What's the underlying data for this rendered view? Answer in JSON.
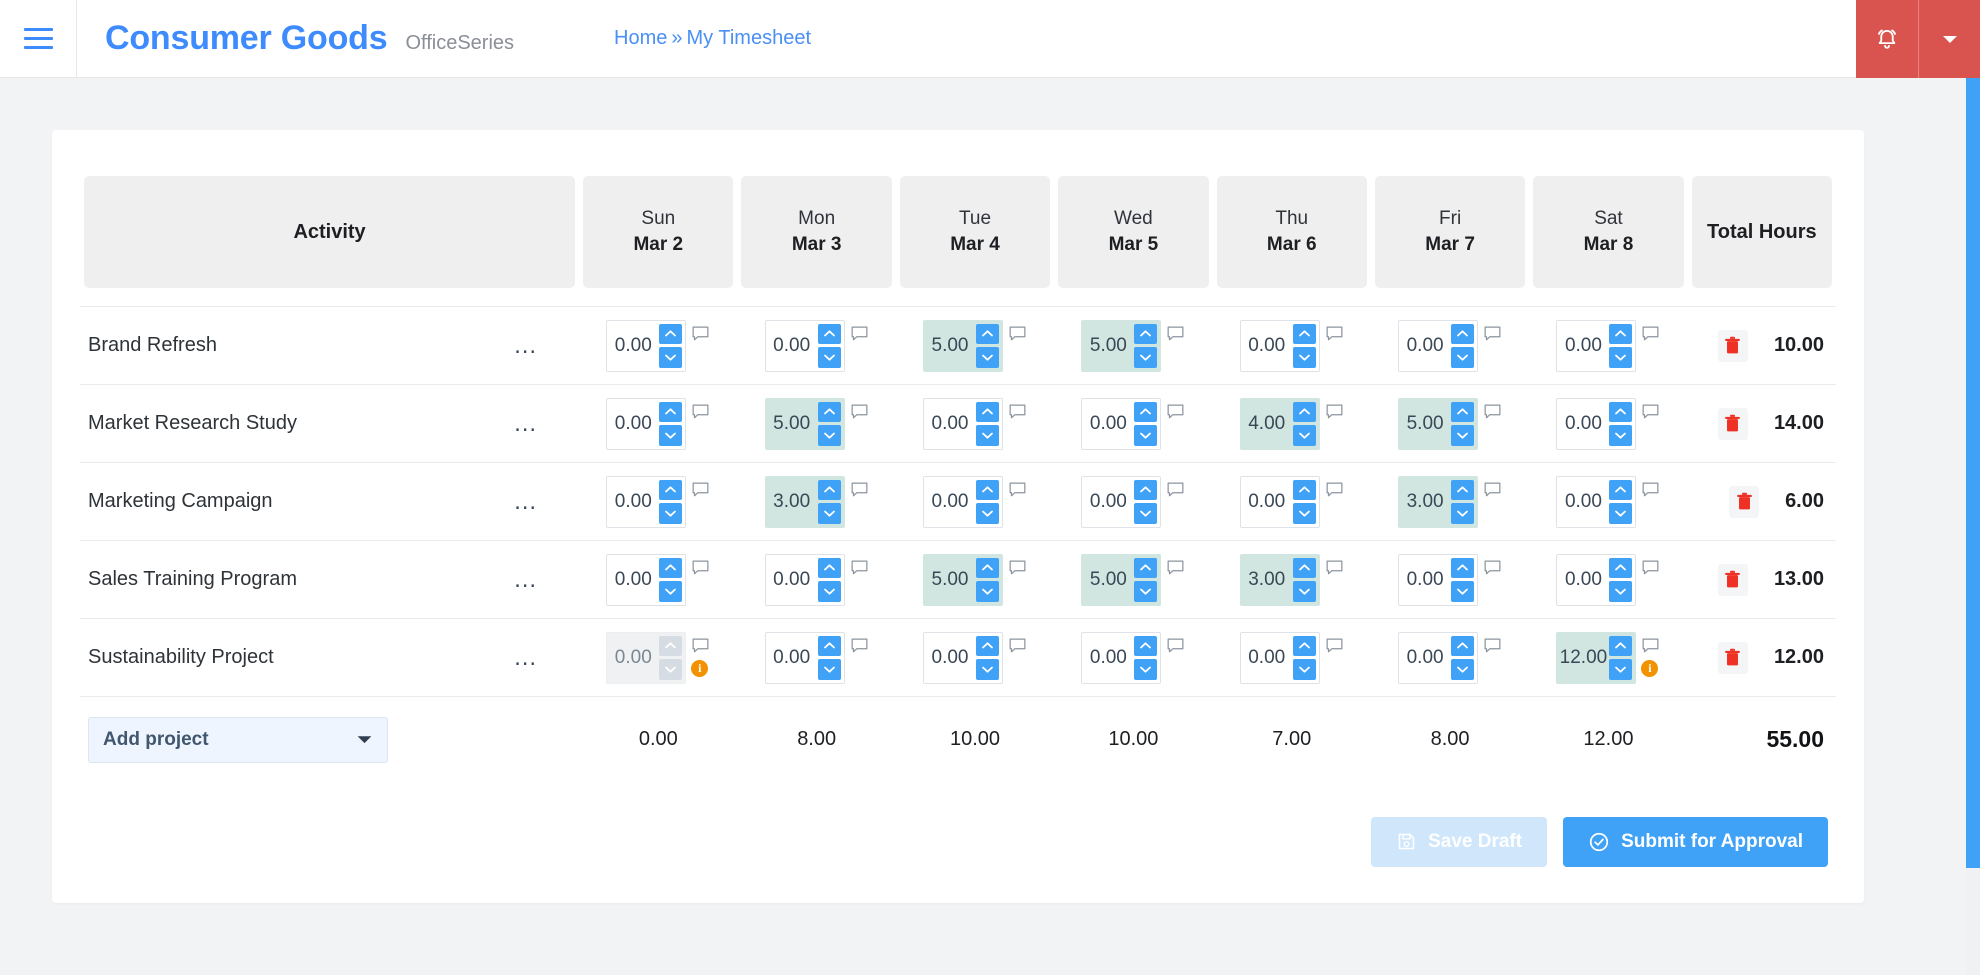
{
  "header": {
    "brand_title": "Consumer Goods",
    "brand_subtitle": "OfficeSeries",
    "breadcrumb": {
      "home": "Home",
      "separator": "»",
      "current": "My Timesheet"
    },
    "notification_icon": "alarm-bell-icon",
    "notification_caret_icon": "chevron-down-icon",
    "menu_icon": "hamburger-menu-icon",
    "accent_color": "#3d8bfd",
    "alert_color": "#d9534f"
  },
  "table": {
    "activity_header": "Activity",
    "total_header": "Total Hours",
    "days": [
      {
        "dow": "Sun",
        "date": "Mar 2"
      },
      {
        "dow": "Mon",
        "date": "Mar 3"
      },
      {
        "dow": "Tue",
        "date": "Mar 4"
      },
      {
        "dow": "Wed",
        "date": "Mar 5"
      },
      {
        "dow": "Thu",
        "date": "Mar 6"
      },
      {
        "dow": "Fri",
        "date": "Mar 7"
      },
      {
        "dow": "Sat",
        "date": "Mar 8"
      }
    ],
    "rows": [
      {
        "activity": "Brand Refresh",
        "menu_icon": "ellipsis-icon",
        "values": [
          "0.00",
          "0.00",
          "5.00",
          "5.00",
          "0.00",
          "0.00",
          "0.00"
        ],
        "filled": [
          false,
          false,
          true,
          true,
          false,
          false,
          false
        ],
        "disabled": [
          false,
          false,
          false,
          false,
          false,
          false,
          false
        ],
        "warnings": [
          false,
          false,
          false,
          false,
          false,
          false,
          false
        ],
        "total": "10.00"
      },
      {
        "activity": "Market Research Study",
        "menu_icon": "ellipsis-icon",
        "values": [
          "0.00",
          "5.00",
          "0.00",
          "0.00",
          "4.00",
          "5.00",
          "0.00"
        ],
        "filled": [
          false,
          true,
          false,
          false,
          true,
          true,
          false
        ],
        "disabled": [
          false,
          false,
          false,
          false,
          false,
          false,
          false
        ],
        "warnings": [
          false,
          false,
          false,
          false,
          false,
          false,
          false
        ],
        "total": "14.00"
      },
      {
        "activity": "Marketing Campaign",
        "menu_icon": "ellipsis-icon",
        "values": [
          "0.00",
          "3.00",
          "0.00",
          "0.00",
          "0.00",
          "3.00",
          "0.00"
        ],
        "filled": [
          false,
          true,
          false,
          false,
          false,
          true,
          false
        ],
        "disabled": [
          false,
          false,
          false,
          false,
          false,
          false,
          false
        ],
        "warnings": [
          false,
          false,
          false,
          false,
          false,
          false,
          false
        ],
        "total": "6.00"
      },
      {
        "activity": "Sales Training Program",
        "menu_icon": "ellipsis-icon",
        "values": [
          "0.00",
          "0.00",
          "5.00",
          "5.00",
          "3.00",
          "0.00",
          "0.00"
        ],
        "filled": [
          false,
          false,
          true,
          true,
          true,
          false,
          false
        ],
        "disabled": [
          false,
          false,
          false,
          false,
          false,
          false,
          false
        ],
        "warnings": [
          false,
          false,
          false,
          false,
          false,
          false,
          false
        ],
        "total": "13.00"
      },
      {
        "activity": "Sustainability Project",
        "menu_icon": "ellipsis-icon",
        "values": [
          "0.00",
          "0.00",
          "0.00",
          "0.00",
          "0.00",
          "0.00",
          "12.00"
        ],
        "filled": [
          false,
          false,
          false,
          false,
          false,
          false,
          true
        ],
        "disabled": [
          true,
          false,
          false,
          false,
          false,
          false,
          false
        ],
        "warnings": [
          true,
          false,
          false,
          false,
          false,
          false,
          true
        ],
        "total": "12.00"
      }
    ],
    "delete_icon": "trash-icon",
    "comment_icon": "comment-icon",
    "warning_icon": "info-badge-icon",
    "spinner_up_icon": "chevron-up-icon",
    "spinner_down_icon": "chevron-down-icon",
    "filled_cell_color": "#d2e6e1",
    "spinner_button_color": "#3fa2f7",
    "warning_badge_color": "#f39200"
  },
  "totals_row": {
    "add_project_label": "Add project",
    "add_project_caret_icon": "caret-down-icon",
    "day_totals": [
      "0.00",
      "8.00",
      "10.00",
      "10.00",
      "7.00",
      "8.00",
      "12.00"
    ],
    "grand_total": "55.00"
  },
  "footer": {
    "save_draft_label": "Save Draft",
    "save_draft_icon": "floppy-disk-icon",
    "save_draft_disabled": true,
    "submit_label": "Submit for Approval",
    "submit_icon": "check-circle-icon",
    "submit_color": "#3fa2f7"
  }
}
